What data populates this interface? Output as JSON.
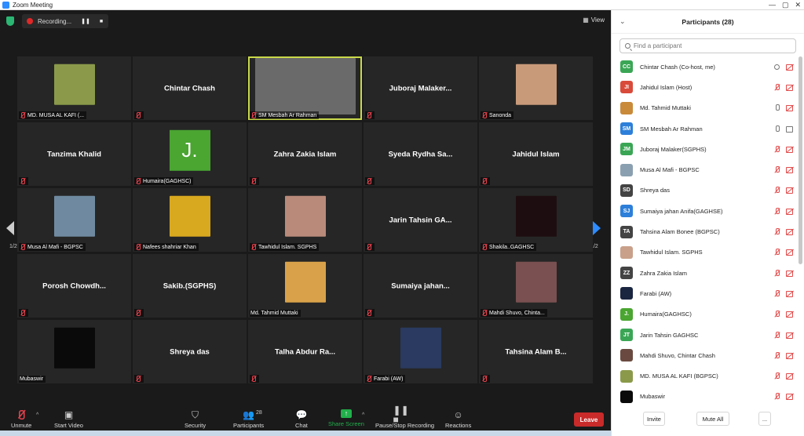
{
  "window": {
    "title": "Zoom Meeting",
    "controls": [
      "—",
      "▢",
      "✕"
    ]
  },
  "meeting": {
    "recording_label": "Recording...",
    "view_label": "View",
    "page_indicator_left": "1/2",
    "page_indicator_right": "1/2",
    "tiles": [
      {
        "name": "MD. MUSA AL KAFI (...",
        "type": "photo",
        "color": "#8a9a4a",
        "bigname": ""
      },
      {
        "name": "",
        "type": "name",
        "bigname": "Chintar Chash"
      },
      {
        "name": "SM Mesbah Ar Rahman",
        "type": "video",
        "color": "#6a6a6a",
        "bigname": "",
        "active": true
      },
      {
        "name": "",
        "type": "name",
        "bigname": "Juboraj Malaker..."
      },
      {
        "name": "Sanonda",
        "type": "photo",
        "color": "#c99a7a",
        "bigname": ""
      },
      {
        "name": "",
        "type": "name",
        "bigname": "Tanzima Khalid"
      },
      {
        "name": "Humaira(GAGHSC)",
        "type": "letter",
        "letter": "J.",
        "bigname": ""
      },
      {
        "name": "",
        "type": "name",
        "bigname": "Zahra Zakia Islam"
      },
      {
        "name": "",
        "type": "name",
        "bigname": "Syeda Rydha Sa..."
      },
      {
        "name": "",
        "type": "name",
        "bigname": "Jahidul Islam"
      },
      {
        "name": "Musa Al Mafi - BGPSC",
        "type": "photo",
        "color": "#6f8aa0",
        "bigname": ""
      },
      {
        "name": "Nafees shahriar Khan",
        "type": "photo",
        "color": "#d8a81e",
        "bigname": ""
      },
      {
        "name": "Tawhidul Islam. SGPHS",
        "type": "photo",
        "color": "#b98a7a",
        "bigname": ""
      },
      {
        "name": "",
        "type": "name",
        "bigname": "Jarin Tahsin GA..."
      },
      {
        "name": "Shakila..GAGHSC",
        "type": "photo",
        "color": "#1e0d10",
        "bigname": ""
      },
      {
        "name": "",
        "type": "name",
        "bigname": "Porosh Chowdh..."
      },
      {
        "name": "",
        "type": "name",
        "bigname": "Sakib.(SGPHS)"
      },
      {
        "name": "Md. Tahmid Muttaki",
        "type": "photo",
        "color": "#d9a24a",
        "bigname": "",
        "nomic": true
      },
      {
        "name": "",
        "type": "name",
        "bigname": "Sumaiya jahan..."
      },
      {
        "name": "Mahdi Shuvo, Chinta...",
        "type": "photo",
        "color": "#7a5050",
        "bigname": ""
      },
      {
        "name": "Mubaswir",
        "type": "photo",
        "color": "#0a0a0a",
        "bigname": "",
        "nomic": true
      },
      {
        "name": "",
        "type": "name",
        "bigname": "Shreya das"
      },
      {
        "name": "",
        "type": "name",
        "bigname": "Talha Abdur Ra..."
      },
      {
        "name": "Farabi (AW)",
        "type": "photo",
        "color": "#2a3a60",
        "bigname": ""
      },
      {
        "name": "",
        "type": "name",
        "bigname": "Tahsina Alam B..."
      }
    ]
  },
  "toolbar": {
    "unmute": "Unmute",
    "start_video": "Start Video",
    "security": "Security",
    "participants": "Participants",
    "participants_count": "28",
    "chat": "Chat",
    "share_screen": "Share Screen",
    "pause_recording": "Pause/Stop Recording",
    "reactions": "Reactions",
    "leave": "Leave"
  },
  "panel": {
    "title": "Participants (28)",
    "search_placeholder": "Find a participant",
    "invite": "Invite",
    "mute_all": "Mute All",
    "more": "...",
    "participants": [
      {
        "name": "Chintar Chash (Co-host, me)",
        "initials": "CC",
        "color": "#3aa655",
        "mic": "rec",
        "cam": "red"
      },
      {
        "name": "Jahidul Islam (Host)",
        "initials": "JI",
        "color": "#d94a3a",
        "mic": "red",
        "cam": "red"
      },
      {
        "name": "Md. Tahmid Muttaki",
        "initials": "",
        "color": "#c98a3a",
        "mic": "grey",
        "cam": "red"
      },
      {
        "name": "SM Mesbah Ar Rahman",
        "initials": "SM",
        "color": "#2d7fd9",
        "mic": "grey",
        "cam": "grey"
      },
      {
        "name": "Juboraj Malaker(SGPHS)",
        "initials": "JM",
        "color": "#3aa655",
        "mic": "red",
        "cam": "red"
      },
      {
        "name": "Musa Al Mafi - BGPSC",
        "initials": "",
        "color": "#8aa0b0",
        "mic": "red",
        "cam": "red"
      },
      {
        "name": "Shreya das",
        "initials": "SD",
        "color": "#444444",
        "mic": "red",
        "cam": "red"
      },
      {
        "name": "Sumaiya jahan Anifa(GAGHSE)",
        "initials": "SJ",
        "color": "#2d7fd9",
        "mic": "red",
        "cam": "red"
      },
      {
        "name": "Tahsina Alam Bonee (BGPSC)",
        "initials": "TA",
        "color": "#444444",
        "mic": "red",
        "cam": "red"
      },
      {
        "name": "Tawhidul Islam. SGPHS",
        "initials": "",
        "color": "#c9a08a",
        "mic": "red",
        "cam": "red"
      },
      {
        "name": "Zahra Zakia Islam",
        "initials": "ZZ",
        "color": "#444444",
        "mic": "red",
        "cam": "red"
      },
      {
        "name": "Farabi (AW)",
        "initials": "",
        "color": "#1a2540",
        "mic": "red",
        "cam": "red"
      },
      {
        "name": "Humaira(GAGHSC)",
        "initials": "J.",
        "color": "#4aa531",
        "mic": "red",
        "cam": "red"
      },
      {
        "name": "Jarin Tahsin GAGHSC",
        "initials": "JT",
        "color": "#3aa655",
        "mic": "red",
        "cam": "red"
      },
      {
        "name": "Mahdi Shuvo, Chintar Chash",
        "initials": "",
        "color": "#6a4a40",
        "mic": "red",
        "cam": "red"
      },
      {
        "name": "MD. MUSA AL KAFI (BGPSC)",
        "initials": "",
        "color": "#8a9a4a",
        "mic": "red",
        "cam": "red"
      },
      {
        "name": "Mubaswir",
        "initials": "",
        "color": "#0a0a0a",
        "mic": "red",
        "cam": "red"
      }
    ]
  }
}
